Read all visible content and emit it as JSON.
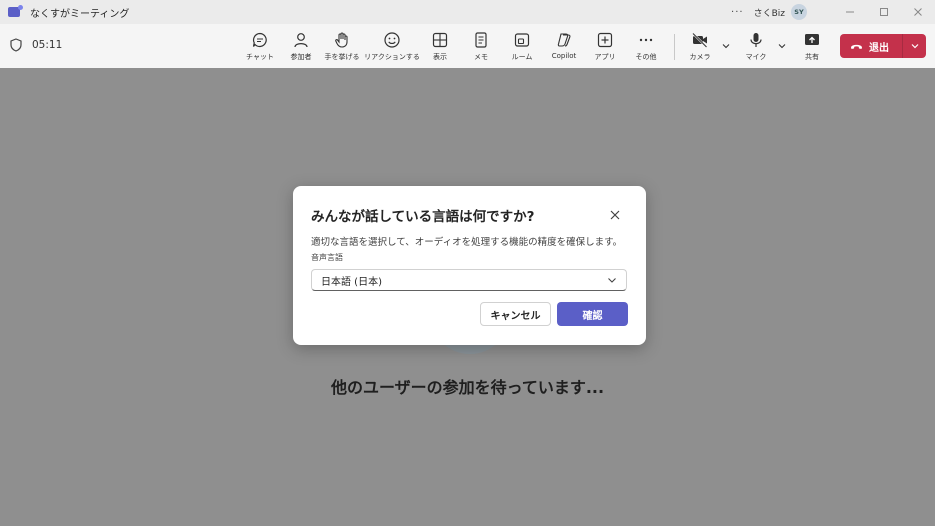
{
  "window": {
    "title": "なくすがミーティング",
    "more": "···",
    "tenant": "さくBiz",
    "user_initials": "SY"
  },
  "toolbar": {
    "timer": "05:11",
    "buttons": {
      "chat": "チャット",
      "people": "参加者",
      "raise": "手を挙げる",
      "react": "リアクションする",
      "view": "表示",
      "notes": "メモ",
      "rooms": "ルーム",
      "copilot": "Copilot",
      "apps": "アプリ",
      "more": "その他",
      "camera": "カメラ",
      "mic": "マイク",
      "share": "共有"
    },
    "leave_label": "退出"
  },
  "stage": {
    "waiting_text": "他のユーザーの参加を待っています..."
  },
  "dialog": {
    "title": "みんなが話している言語は何ですか?",
    "description": "適切な言語を選択して、オーディオを処理する機能の精度を確保します。",
    "field_label": "音声言語",
    "selected_language": "日本語 (日本)",
    "cancel_label": "キャンセル",
    "confirm_label": "確認"
  },
  "colors": {
    "accent": "#5b5fc7",
    "leave": "#c4314b",
    "overlay": "#8f8f8f"
  }
}
